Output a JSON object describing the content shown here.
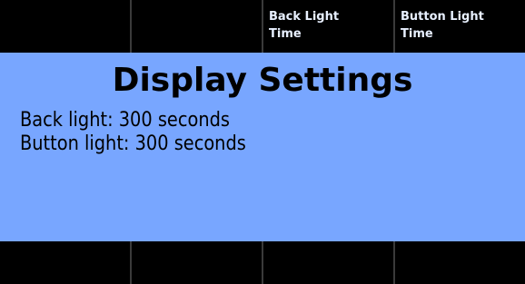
{
  "top_softkeys": [
    {
      "line1": "",
      "line2": ""
    },
    {
      "line1": "",
      "line2": ""
    },
    {
      "line1": "Back Light",
      "line2": "Time"
    },
    {
      "line1": "Button Light",
      "line2": "Time"
    }
  ],
  "bottom_softkeys": [
    {
      "label": ""
    },
    {
      "label": ""
    },
    {
      "label": ""
    },
    {
      "label": ""
    }
  ],
  "screen": {
    "title": "Display Settings",
    "lines": [
      "Back light: 300 seconds",
      "Button light: 300 seconds"
    ]
  },
  "colors": {
    "background": "#000000",
    "screen": "#78a6ff",
    "softkey_text": "#e8f0ff"
  }
}
